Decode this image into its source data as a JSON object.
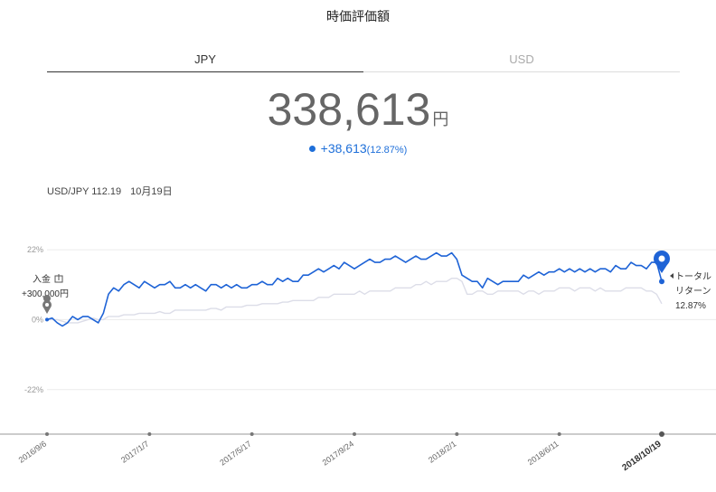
{
  "title": "時価評価額",
  "tabs": [
    {
      "label": "JPY",
      "active": true
    },
    {
      "label": "USD",
      "active": false
    }
  ],
  "valuation": {
    "amount": "338,613",
    "unit": "円"
  },
  "gain": {
    "amount": "+38,613",
    "percent": "(12.87%)"
  },
  "fx": {
    "rate": "USD/JPY 112.19",
    "date": "10月19日"
  },
  "annotations": {
    "deposit_label": "入金",
    "deposit_amount": "+300,000円",
    "total_line1": "トータル",
    "total_line2": "リターン",
    "total_value": "12.87%"
  },
  "chart_data": {
    "type": "line",
    "y_ticks": [
      "22%",
      "0%",
      "-22%"
    ],
    "y_tick_values": [
      22,
      0,
      -22
    ],
    "x_ticks": [
      "2016/9/6",
      "2017/1/7",
      "2017/5/17",
      "2017/9/24",
      "2018/2/1",
      "2018/6/11",
      "2018/10/19"
    ],
    "x_tick_index": [
      0,
      20,
      40,
      60,
      80,
      100,
      120
    ],
    "series": [
      {
        "name": "total_return",
        "color": "#1e63d6",
        "values": [
          0,
          0.5,
          -1,
          -2,
          -1,
          1,
          0,
          1,
          1,
          0,
          -1,
          2,
          8,
          10,
          9,
          11,
          12,
          11,
          10,
          12,
          11,
          10,
          11,
          11,
          12,
          10,
          10,
          11,
          10,
          11,
          10,
          9,
          11,
          11,
          10,
          11,
          10,
          11,
          10,
          10,
          11,
          11,
          12,
          11,
          11,
          13,
          12,
          13,
          12,
          12,
          14,
          14,
          15,
          16,
          15,
          16,
          17,
          16,
          18,
          17,
          16,
          17,
          18,
          19,
          18,
          18,
          19,
          19,
          20,
          19,
          18,
          19,
          20,
          19,
          19,
          20,
          21,
          20,
          20,
          21,
          19,
          14,
          13,
          12,
          12,
          10,
          13,
          12,
          11,
          12,
          12,
          12,
          12,
          14,
          13,
          14,
          15,
          14,
          15,
          15,
          16,
          15,
          16,
          15,
          16,
          15,
          16,
          15,
          16,
          16,
          15,
          17,
          16,
          16,
          18,
          17,
          17,
          16,
          18,
          18,
          12
        ]
      },
      {
        "name": "benchmark",
        "color": "#dcdde8",
        "values": [
          0,
          0,
          0,
          -0.5,
          -1,
          -1,
          -1,
          -0.5,
          0,
          0.5,
          0,
          0,
          1,
          1,
          1,
          1.5,
          1.5,
          1.5,
          2,
          2,
          2,
          2,
          2.5,
          2,
          2,
          3,
          3,
          3,
          3,
          3,
          3,
          3,
          3.5,
          3.5,
          3,
          4,
          4,
          4,
          4,
          4.5,
          4.5,
          4.5,
          5,
          5,
          5,
          5,
          5.5,
          5.5,
          6,
          6,
          6,
          6,
          6,
          7,
          7,
          7,
          8,
          8,
          8,
          8,
          8,
          9,
          8,
          9,
          9,
          9,
          9,
          9,
          10,
          10,
          10,
          10,
          11,
          11,
          12,
          11,
          12,
          12,
          12,
          13,
          13,
          12,
          8,
          8,
          9,
          9,
          8,
          8,
          9,
          9,
          9,
          9,
          9,
          8,
          9,
          9,
          8,
          9,
          9,
          9,
          10,
          10,
          10,
          9,
          10,
          10,
          10,
          9,
          10,
          9,
          9,
          9,
          9,
          10,
          10,
          10,
          10,
          9,
          9,
          8,
          5
        ]
      }
    ],
    "y_range": [
      -36,
      26
    ],
    "legend": "none"
  }
}
